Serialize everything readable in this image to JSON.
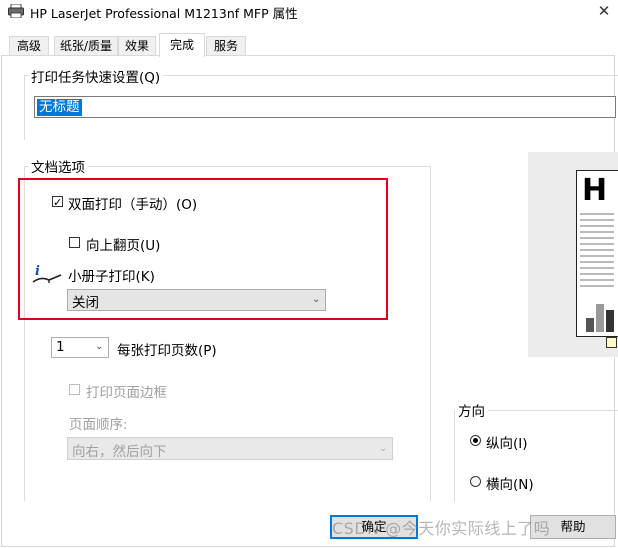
{
  "window": {
    "title": "HP LaserJet Professional M1213nf MFP 属性",
    "close_glyph": "✕"
  },
  "tabs": [
    {
      "label": "高级",
      "active": false
    },
    {
      "label": "纸张/质量",
      "active": false
    },
    {
      "label": "效果",
      "active": false
    },
    {
      "label": "完成",
      "active": true
    },
    {
      "label": "服务",
      "active": false
    }
  ],
  "quick_set": {
    "heading": "打印任务快速设置(Q)",
    "value": "无标题"
  },
  "doc_options": {
    "heading": "文档选项",
    "duplex": {
      "label": "双面打印（手动）(O)",
      "checked": true
    },
    "flip_up": {
      "label": "向上翻页(U)",
      "checked": false
    },
    "booklet": {
      "label": "小册子打印(K)",
      "value": "关闭",
      "icon": "info-icon"
    },
    "pages_per_sheet": {
      "value": "1",
      "label": "每张打印页数(P)"
    },
    "print_borders": {
      "label": "打印页面边框",
      "checked": false,
      "enabled": false
    },
    "page_order": {
      "label": "页面顺序:",
      "value": "向右，然后向下",
      "enabled": false
    }
  },
  "orientation": {
    "heading": "方向",
    "portrait": {
      "label": "纵向(I)",
      "selected": true
    },
    "landscape": {
      "label": "横向(N)",
      "selected": false
    }
  },
  "preview": {
    "letter": "H"
  },
  "buttons": {
    "ok": "确定",
    "help": "帮助"
  },
  "watermark": "CSDN @今天你实际线上了吗",
  "colors": {
    "highlight": "#e0001b",
    "selection": "#0078d7"
  }
}
